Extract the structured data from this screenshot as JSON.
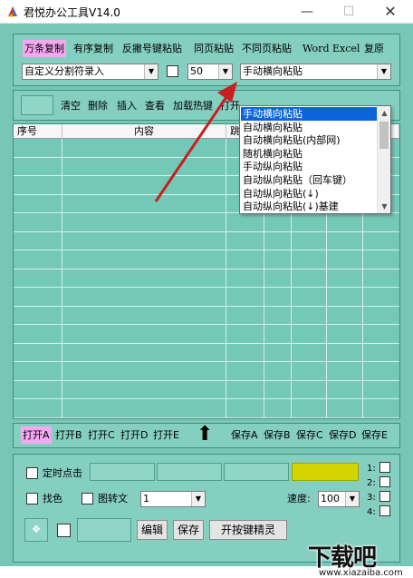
{
  "window": {
    "title": "君悦办公工具V14.0",
    "min": "—",
    "max": "☐",
    "close": "✕"
  },
  "toolbar1": {
    "buttons": [
      "万条复制",
      "有序复制",
      "反撇号键粘贴",
      "同页粘贴",
      "不同页粘贴",
      "Word",
      "Excel",
      "复原"
    ],
    "separator_select": "自定义分割符录入",
    "count_select": "50",
    "paste_mode_select": "手动横向粘贴"
  },
  "toolbar2": {
    "buttons": [
      "清空",
      "删除",
      "插入",
      "查看",
      "加载热键",
      "打开"
    ]
  },
  "table": {
    "columns": [
      "序号",
      "内容",
      "跳"
    ],
    "rows": 15
  },
  "paste_dropdown": {
    "options": [
      "手动横向粘贴",
      "自动横向粘贴",
      "自动横向粘贴(内部网)",
      "随机横向粘贴",
      "手动纵向粘贴",
      "自动纵向粘贴（回车键）",
      "自动纵向粘贴(↓)",
      "自动纵向粘贴(↓)基建"
    ],
    "selected_index": 0
  },
  "toolbar4": {
    "open_buttons": [
      "打开A",
      "打开B",
      "打开C",
      "打开D",
      "打开E"
    ],
    "save_buttons": [
      "保存A",
      "保存B",
      "保存C",
      "保存D",
      "保存E"
    ],
    "up_arrow": "⬆"
  },
  "bottom": {
    "timed_click_label": "定时点击",
    "find_color_label": "找色",
    "image_to_text_label": "图转文",
    "find_select": "1",
    "speed_label": "速度:",
    "speed_select": "100",
    "edit_label": "编辑",
    "save_label": "保存",
    "hotkey_button_label": "开按键精灵",
    "side_labels": [
      "1:",
      "2:",
      "3:",
      "4:"
    ],
    "indicator_color": "#d4d400"
  },
  "watermark": {
    "logo": "下载吧",
    "url": "www.xiazaiba.com"
  }
}
